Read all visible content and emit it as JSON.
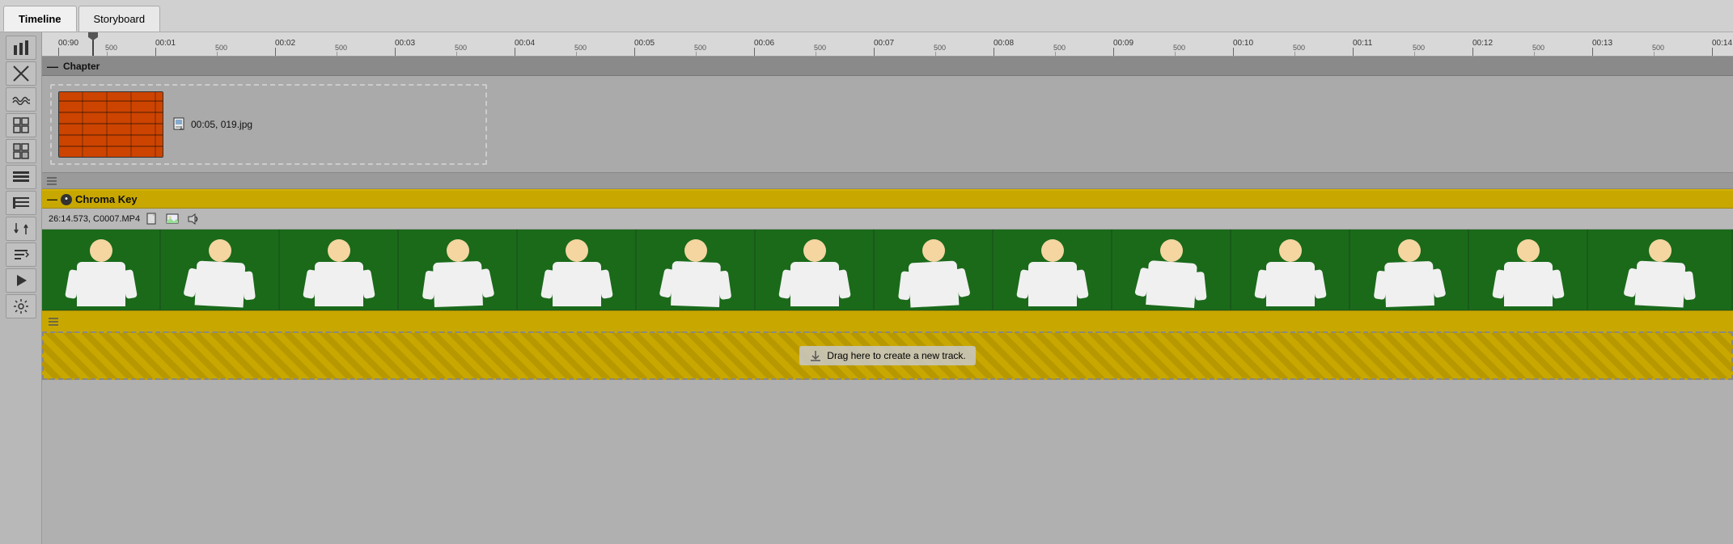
{
  "tabs": [
    {
      "id": "timeline",
      "label": "Timeline",
      "active": true
    },
    {
      "id": "storyboard",
      "label": "Storyboard",
      "active": false
    }
  ],
  "toolbar": {
    "icons": [
      {
        "name": "zoom-icon",
        "symbol": "⛶"
      },
      {
        "name": "razor-icon",
        "symbol": "✂"
      },
      {
        "name": "wave-icon",
        "symbol": "≋"
      },
      {
        "name": "grid-icon",
        "symbol": "⊞"
      },
      {
        "name": "link-icon",
        "symbol": "⊡"
      },
      {
        "name": "film-icon",
        "symbol": "▬"
      },
      {
        "name": "list-icon",
        "symbol": "≡"
      },
      {
        "name": "list2-icon",
        "symbol": "≣"
      },
      {
        "name": "sort-icon",
        "symbol": "⇅"
      },
      {
        "name": "arrow-right-icon",
        "symbol": "▷"
      },
      {
        "name": "settings-icon",
        "symbol": "⚙"
      }
    ]
  },
  "ruler": {
    "marks": [
      {
        "time": "00:00",
        "offset": 20
      },
      {
        "time": "00:01",
        "offset": 140
      },
      {
        "time": "00:02",
        "offset": 288
      },
      {
        "time": "00:03",
        "offset": 436
      },
      {
        "time": "00:04",
        "offset": 584
      },
      {
        "time": "00:05",
        "offset": 732
      },
      {
        "time": "00:06",
        "offset": 880
      },
      {
        "time": "00:07",
        "offset": 1028
      },
      {
        "time": "00:08",
        "offset": 1176
      },
      {
        "time": "00:09",
        "offset": 1324
      },
      {
        "time": "00:10",
        "offset": 1472
      },
      {
        "time": "00:11",
        "offset": 1620
      },
      {
        "time": "00:12",
        "offset": 1768
      },
      {
        "time": "00:13",
        "offset": 1916
      },
      {
        "time": "00:14",
        "offset": 2064
      }
    ],
    "minor_label": "500"
  },
  "tracks": {
    "chapter": {
      "header_label": "Chapter",
      "clip": {
        "timecode": "00:05",
        "filename": "019.jpg"
      }
    },
    "chroma_key": {
      "header_label": "Chroma Key",
      "video_info": "26:14.573, C0007.MP4",
      "frame_count": 14,
      "drop_label": "Drag here to create a new track."
    }
  }
}
